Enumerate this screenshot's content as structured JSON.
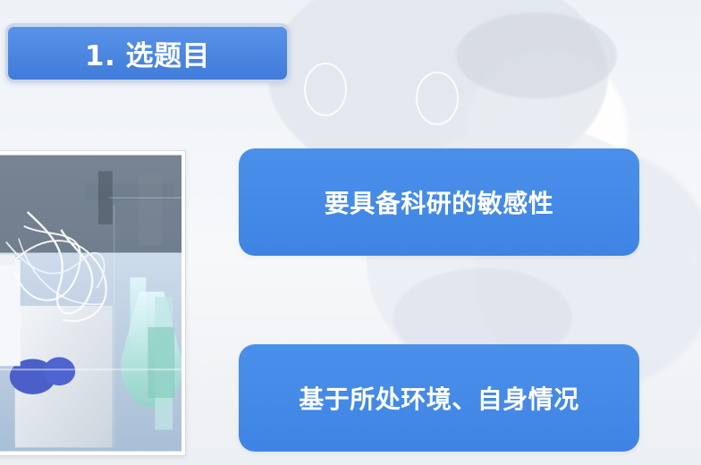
{
  "slide": {
    "title": "1. 选题目",
    "box_1": "要具备科研的敏感性",
    "box_2": "基于所处环境、自身情况"
  },
  "colors": {
    "title_fill": "#4d88e2",
    "info_fill": "#4a90ea",
    "text": "#ffffff"
  }
}
